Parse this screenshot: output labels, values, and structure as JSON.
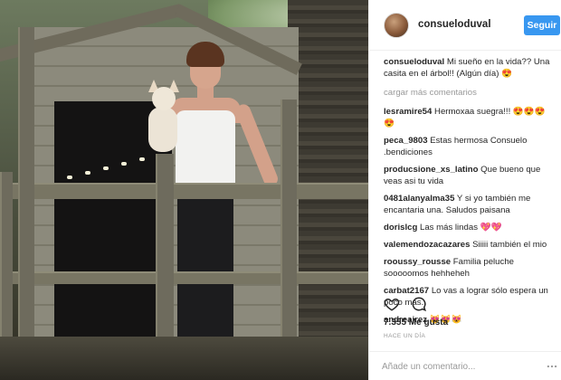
{
  "post": {
    "username": "consueloduval",
    "follow_label": "Seguir",
    "caption_user": "consueloduval",
    "caption_text": "Mi sueño en la vida?? Una casita en el árbol!! (Algún día) 😍",
    "load_more": "cargar más comentarios",
    "comments": [
      {
        "user": "lesramire54",
        "text": "Hermoxaa suegra!!! 😍😍😍😍"
      },
      {
        "user": "peca_9803",
        "text": "Estas hermosa Consuelo .bendiciones"
      },
      {
        "user": "producsione_xs_latino",
        "text": "Que bueno que veas asi tu vida"
      },
      {
        "user": "0481alanyalma35",
        "text": "Y si yo también me encantaria una. Saludos paisana"
      },
      {
        "user": "dorislcg",
        "text": "Las más lindas 💖💖"
      },
      {
        "user": "valemendozacazares",
        "text": "Siiiii también el mio"
      },
      {
        "user": "rooussy_rousse",
        "text": "Familia peluche sooooomos hehheheh"
      },
      {
        "user": "carbat2167",
        "text": "Lo vas a lograr sólo espera un poco más."
      },
      {
        "user": "andreajrez",
        "text": "😻😻😻"
      }
    ],
    "likes": "7.355 Me gusta",
    "timestamp": "HACE UN DÍA",
    "comment_placeholder": "Añade un comentario...",
    "icons": {
      "like": "heart-icon",
      "comment": "comment-icon",
      "options": "more-options-icon"
    },
    "colors": {
      "follow_button": "#3897f0",
      "meta_text": "#999999",
      "text": "#262626"
    }
  }
}
